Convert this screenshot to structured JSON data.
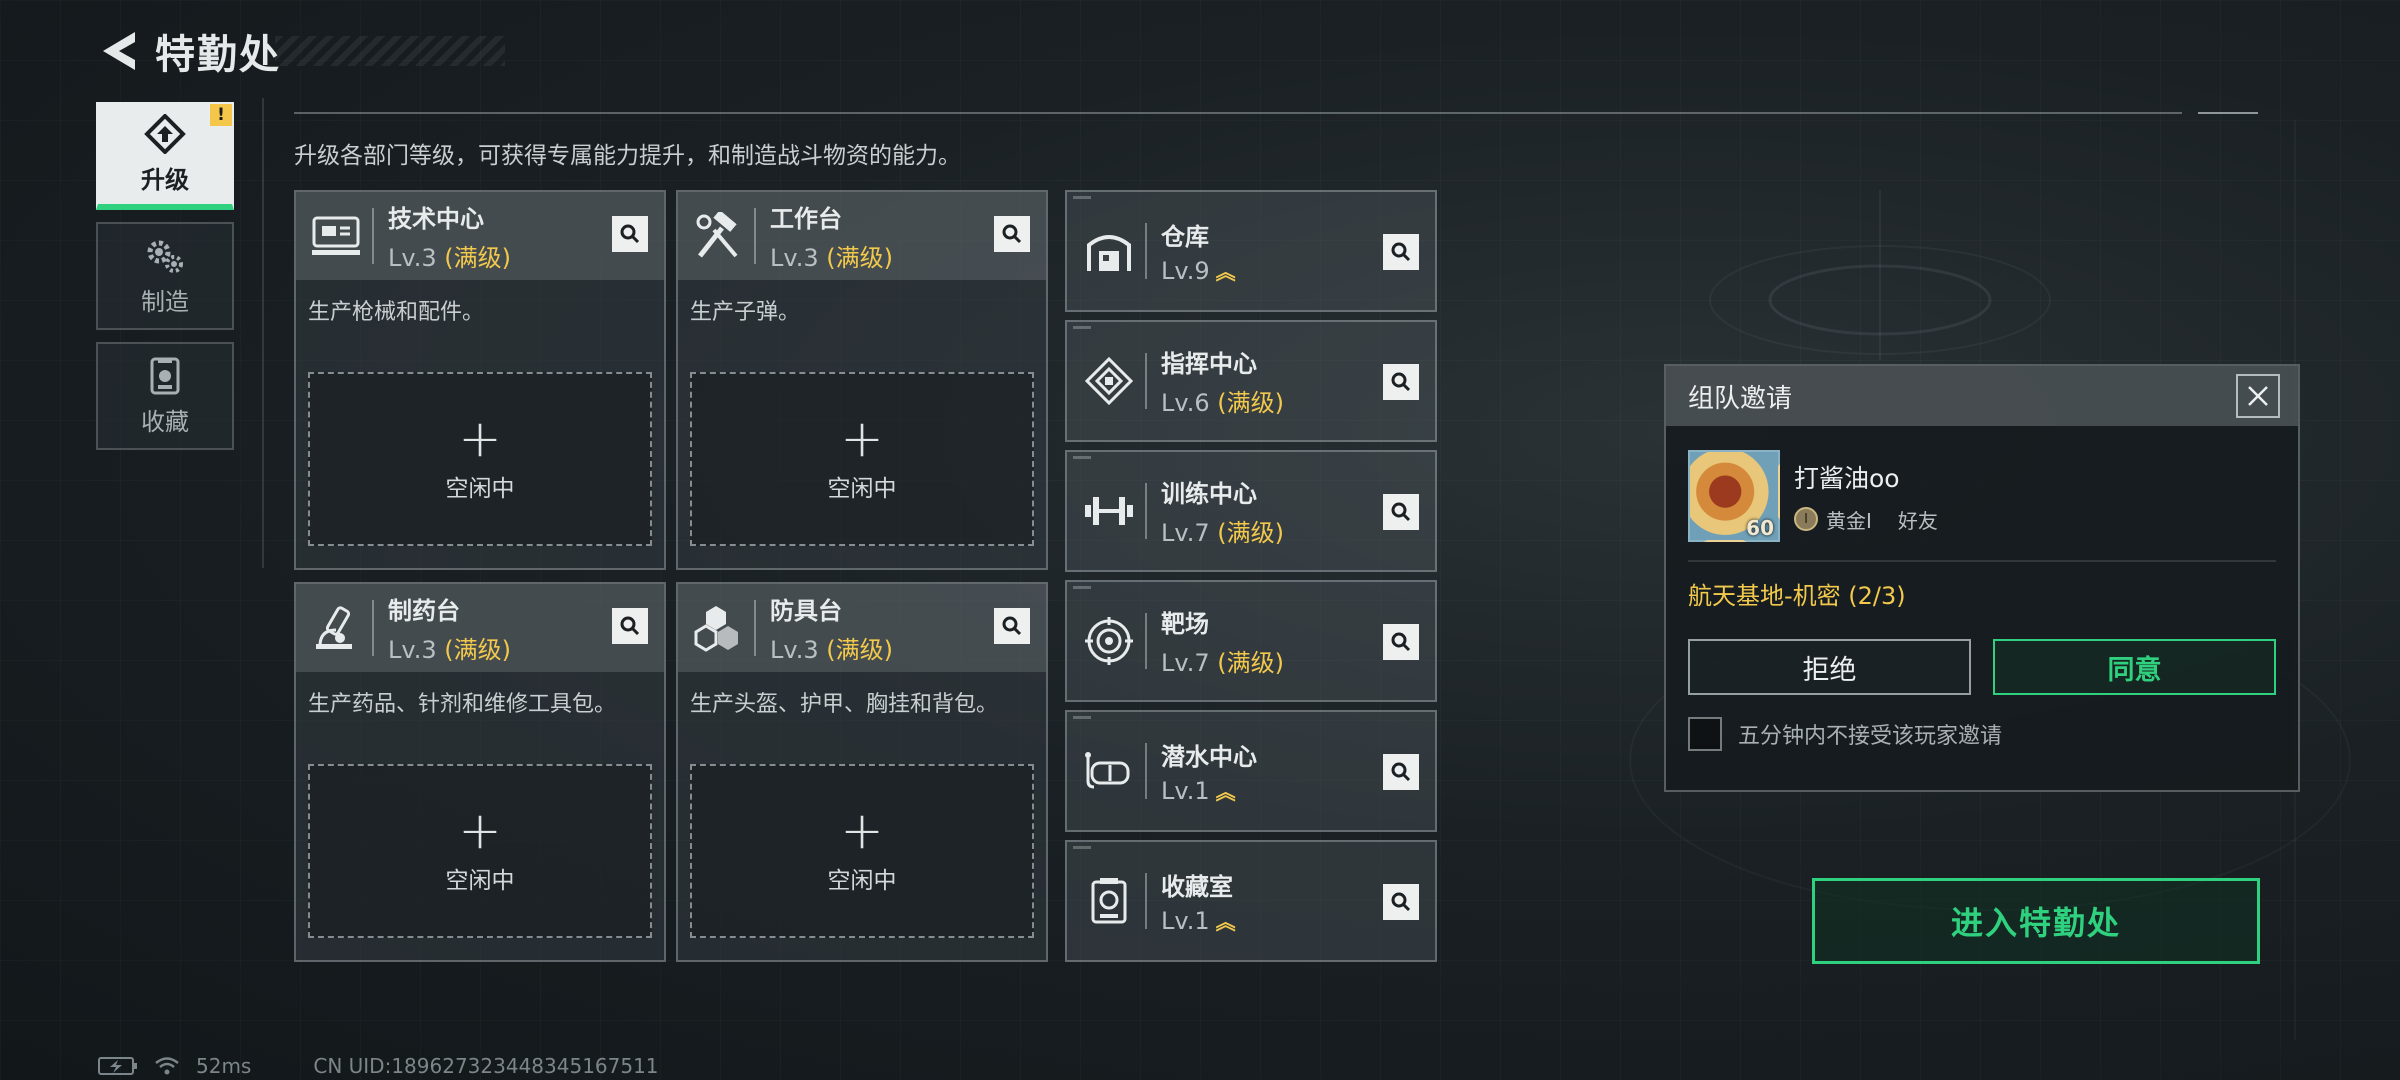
{
  "header": {
    "title": "特勤处"
  },
  "side_tabs": [
    {
      "label": "升级",
      "icon": "upgrade-icon",
      "active": true,
      "badge": "!"
    },
    {
      "label": "制造",
      "icon": "gears-icon",
      "active": false
    },
    {
      "label": "收藏",
      "icon": "collection-icon",
      "active": false
    }
  ],
  "intro": "升级各部门等级，可获得专属能力提升，和制造战斗物资的能力。",
  "big_cards": [
    {
      "name": "技术中心",
      "lv": "Lv.3",
      "max": "(满级)",
      "desc": "生产枪械和配件。",
      "slot": "空闲中",
      "icon": "tech-center-icon"
    },
    {
      "name": "工作台",
      "lv": "Lv.3",
      "max": "(满级)",
      "desc": "生产子弹。",
      "slot": "空闲中",
      "icon": "workbench-icon"
    },
    {
      "name": "制药台",
      "lv": "Lv.3",
      "max": "(满级)",
      "desc": "生产药品、针剂和维修工具包。",
      "slot": "空闲中",
      "icon": "pharmacy-icon"
    },
    {
      "name": "防具台",
      "lv": "Lv.3",
      "max": "(满级)",
      "desc": "生产头盔、护甲、胸挂和背包。",
      "slot": "空闲中",
      "icon": "armor-bench-icon"
    }
  ],
  "small_cards": [
    {
      "name": "仓库",
      "lv": "Lv.9",
      "max": "",
      "upgradable": true,
      "icon": "warehouse-icon"
    },
    {
      "name": "指挥中心",
      "lv": "Lv.6",
      "max": "(满级)",
      "upgradable": false,
      "icon": "command-center-icon"
    },
    {
      "name": "训练中心",
      "lv": "Lv.7",
      "max": "(满级)",
      "upgradable": false,
      "icon": "training-center-icon"
    },
    {
      "name": "靶场",
      "lv": "Lv.7",
      "max": "(满级)",
      "upgradable": false,
      "icon": "shooting-range-icon"
    },
    {
      "name": "潜水中心",
      "lv": "Lv.1",
      "max": "",
      "upgradable": true,
      "icon": "diving-center-icon"
    },
    {
      "name": "收藏室",
      "lv": "Lv.1",
      "max": "",
      "upgradable": true,
      "icon": "collection-room-icon"
    }
  ],
  "invite": {
    "title": "组队邀请",
    "user_name": "打酱油oo",
    "avatar_level": "60",
    "rank": "黄金Ⅰ",
    "relation": "好友",
    "mission": "航天基地-机密 (2/3)",
    "refuse_label": "拒绝",
    "agree_label": "同意",
    "checkbox_label": "五分钟内不接受该玩家邀请"
  },
  "enter_button": "进入特勤处",
  "status": {
    "ping": "52ms",
    "uid": "CN UID:1896273234483451675​11"
  },
  "colors": {
    "accent_green": "#2fd17f",
    "max_yellow": "#f2c94c",
    "badge_yellow": "#f4c64a"
  }
}
